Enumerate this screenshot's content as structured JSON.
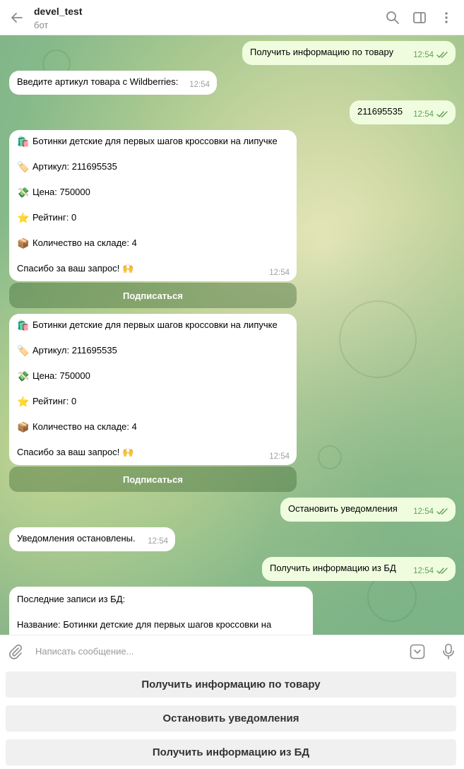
{
  "header": {
    "title": "devel_test",
    "subtitle": "бот"
  },
  "messages": {
    "m1": {
      "text": "Получить информацию по товару",
      "time": "12:54"
    },
    "m2": {
      "text": "Введите артикул товара с Wildberries:",
      "time": "12:54"
    },
    "m3": {
      "text": "211695535",
      "time": "12:54"
    },
    "card1": {
      "name": "Ботинки детские для первых шагов кроссовки на липучке",
      "article": "Артикул: 211695535",
      "price": "Цена: 750000",
      "rating": "Рейтинг: 0",
      "stock": "Количество на складе: 4",
      "thanks": "Спасибо за ваш запрос!",
      "time": "12:54",
      "button": "Подписаться"
    },
    "card2": {
      "name": "Ботинки детские для первых шагов кроссовки на липучке",
      "article": "Артикул: 211695535",
      "price": "Цена: 750000",
      "rating": "Рейтинг: 0",
      "stock": "Количество на складе: 4",
      "thanks": "Спасибо за ваш запрос!",
      "time": "12:54",
      "button": "Подписаться"
    },
    "m4": {
      "text": "Остановить уведомления",
      "time": "12:54"
    },
    "m5": {
      "text": "Уведомления остановлены.",
      "time": "12:54"
    },
    "m6": {
      "text": "Получить информацию из БД",
      "time": "12:54"
    },
    "m7": {
      "line1": "Последние записи из БД:",
      "line2": "Название: Ботинки детские для первых шагов кроссовки на"
    }
  },
  "emoji": {
    "bag": "🛍️",
    "tag": "🏷️",
    "money": "💸",
    "star": "⭐",
    "box": "📦",
    "hands": "🙌"
  },
  "composer": {
    "placeholder": "Написать сообщение..."
  },
  "keyboard": {
    "b1": "Получить информацию по товару",
    "b2": "Остановить уведомления",
    "b3": "Получить информацию из БД"
  },
  "colors": {
    "outgoing": "#effdde",
    "incoming": "#ffffff",
    "check": "#5fa05c"
  }
}
